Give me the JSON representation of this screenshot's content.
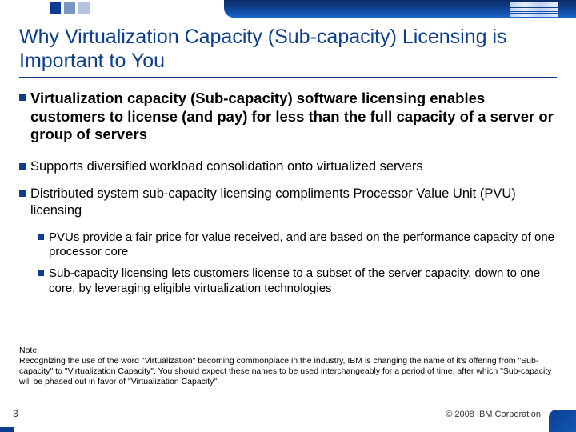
{
  "meta": {
    "page_number": "3",
    "copyright": "© 2008 IBM Corporation",
    "logo_name": "ibm-logo"
  },
  "title": "Why Virtualization Capacity (Sub-capacity) Licensing is Important to You",
  "bullets": {
    "main": "Virtualization capacity (Sub-capacity) software licensing enables customers to license (and pay) for less than the full capacity of a server or group of servers",
    "b2": "Supports diversified workload consolidation onto virtualized servers",
    "b3": "Distributed system sub-capacity licensing compliments Processor Value Unit (PVU) licensing",
    "sub1": "PVUs provide a fair price for value received, and are based on the performance capacity of one processor core",
    "sub2": "Sub-capacity licensing lets customers license to a subset of the server capacity, down to one core, by leveraging eligible virtualization technologies"
  },
  "note": {
    "label": "Note:",
    "text": "Recognizing the use of the word \"Virtualization\" becoming commonplace in the industry, IBM is changing the name of it's offering from \"Sub-capacity\" to \"Virtualization Capacity\". You should expect these names to be used interchangeably for a period of time, after which \"Sub-capacity will be phased out in favor of \"Virtualization Capacity\"."
  }
}
